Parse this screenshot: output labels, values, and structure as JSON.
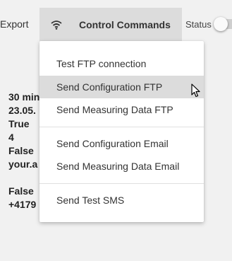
{
  "toolbar": {
    "export_label": "Export",
    "control_commands_label": "Control Commands",
    "control_commands_icon": "wifi-signal-icon",
    "status_label": "Status",
    "status_on": false
  },
  "background_values": [
    "30 min",
    "23.05.",
    "True",
    "4",
    "False",
    "your.a",
    "",
    "False",
    "+4179"
  ],
  "menu": {
    "items": [
      {
        "label": "Test FTP connection",
        "active": false
      },
      {
        "label": "Send Configuration FTP",
        "active": true
      },
      {
        "label": "Send Measuring Data FTP",
        "active": false
      },
      {
        "label": "Send Configuration Email",
        "active": false
      },
      {
        "label": "Send Measuring Data Email",
        "active": false
      },
      {
        "label": "Send Test SMS",
        "active": false
      }
    ]
  },
  "colors": {
    "background": "#f1f1f1",
    "button_bg": "#dcdcdc",
    "menu_bg": "#ffffff",
    "active_item_bg": "#dcdcdc"
  }
}
